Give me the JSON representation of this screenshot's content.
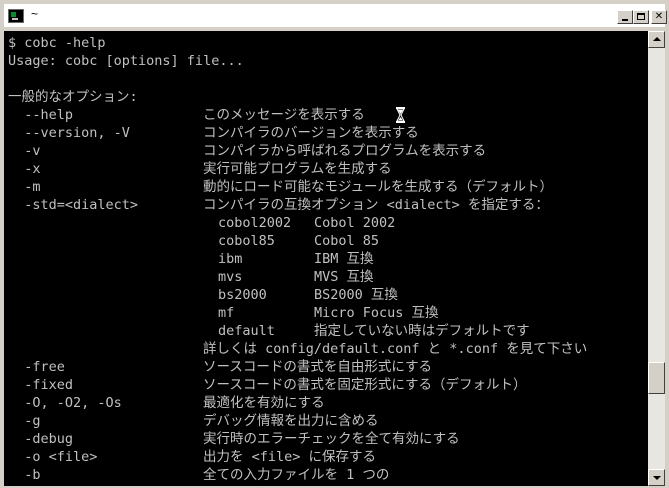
{
  "window": {
    "title": "~",
    "buttons": {
      "minimize": "minimize",
      "maximize": "maximize",
      "close": "✕"
    }
  },
  "terminal": {
    "lines": [
      {
        "opt": "$ cobc -help",
        "desc": ""
      },
      {
        "opt": "Usage: cobc [options] file...",
        "desc": ""
      },
      {
        "opt": "",
        "desc": ""
      },
      {
        "opt": "一般的なオプション:",
        "desc": ""
      },
      {
        "opt": "  --help",
        "desc": "このメッセージを表示する"
      },
      {
        "opt": "  --version, -V",
        "desc": "コンパイラのバージョンを表示する"
      },
      {
        "opt": "  -v",
        "desc": "コンパイラから呼ばれるプログラムを表示する"
      },
      {
        "opt": "  -x",
        "desc": "実行可能プログラムを生成する"
      },
      {
        "opt": "  -m",
        "desc": "動的にロード可能なモジュールを生成する（デフォルト）"
      },
      {
        "opt": "  -std=<dialect>",
        "desc": "コンパイラの互換オプション <dialect> を指定する："
      }
    ],
    "dialects": [
      {
        "name": "cobol2002",
        "desc": "Cobol 2002"
      },
      {
        "name": "cobol85",
        "desc": "Cobol 85"
      },
      {
        "name": "ibm",
        "desc": "IBM 互換"
      },
      {
        "name": "mvs",
        "desc": "MVS 互換"
      },
      {
        "name": "bs2000",
        "desc": "BS2000 互換"
      },
      {
        "name": "mf",
        "desc": "Micro Focus 互換"
      },
      {
        "name": "default",
        "desc": "指定していない時はデフォルトです"
      }
    ],
    "dialect_note": "詳しくは config/default.conf と *.conf を見て下さい",
    "options": [
      {
        "opt": "  -free",
        "desc": "ソースコードの書式を自由形式にする"
      },
      {
        "opt": "  -fixed",
        "desc": "ソースコードの書式を固定形式にする（デフォルト）"
      },
      {
        "opt": "  -O, -O2, -Os",
        "desc": "最適化を有効にする"
      },
      {
        "opt": "  -g",
        "desc": "デバッグ情報を出力に含める"
      },
      {
        "opt": "  -debug",
        "desc": "実行時のエラーチェックを全て有効にする"
      },
      {
        "opt": "  -o <file>",
        "desc": "出力を <file> に保存する"
      },
      {
        "opt": "  -b",
        "desc": "全ての入力ファイルを 1 つの"
      }
    ]
  },
  "icons": {
    "app": "console-app-icon",
    "cursor": "hourglass-icon",
    "scroll_up": "arrow-up-icon",
    "scroll_down": "arrow-down-icon"
  },
  "colors": {
    "terminal_bg": "#000000",
    "terminal_text": "#c0c0c0",
    "titlebar_bg": "#ffffff",
    "chrome": "#d4d0c8"
  }
}
